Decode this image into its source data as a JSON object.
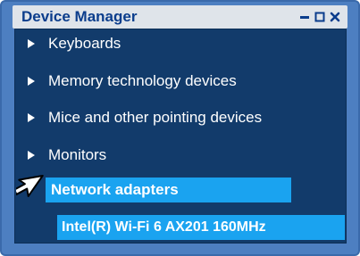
{
  "window": {
    "title": "Device Manager",
    "controls": {
      "minimize_icon": "minimize-icon",
      "maximize_icon": "maximize-icon",
      "close_icon": "close-icon"
    }
  },
  "tree": {
    "items": [
      {
        "label": "Keyboards",
        "expanded": false
      },
      {
        "label": "Memory technology devices",
        "expanded": false
      },
      {
        "label": "Mice and other pointing devices",
        "expanded": false
      },
      {
        "label": "Monitors",
        "expanded": false
      },
      {
        "label": "Network adapters",
        "expanded": true,
        "selected": true
      }
    ],
    "child": {
      "label": "Intel(R) Wi-Fi 6 AX201 160MHz"
    }
  },
  "colors": {
    "window_frame": "#4d7fc1",
    "title_text": "#0b3d8c",
    "panel_bg": "#123b6b",
    "selection": "#1aa3f0",
    "expanded_arrow": "#1aa3f0"
  },
  "cursor": {
    "icon": "mouse-pointer-icon"
  }
}
